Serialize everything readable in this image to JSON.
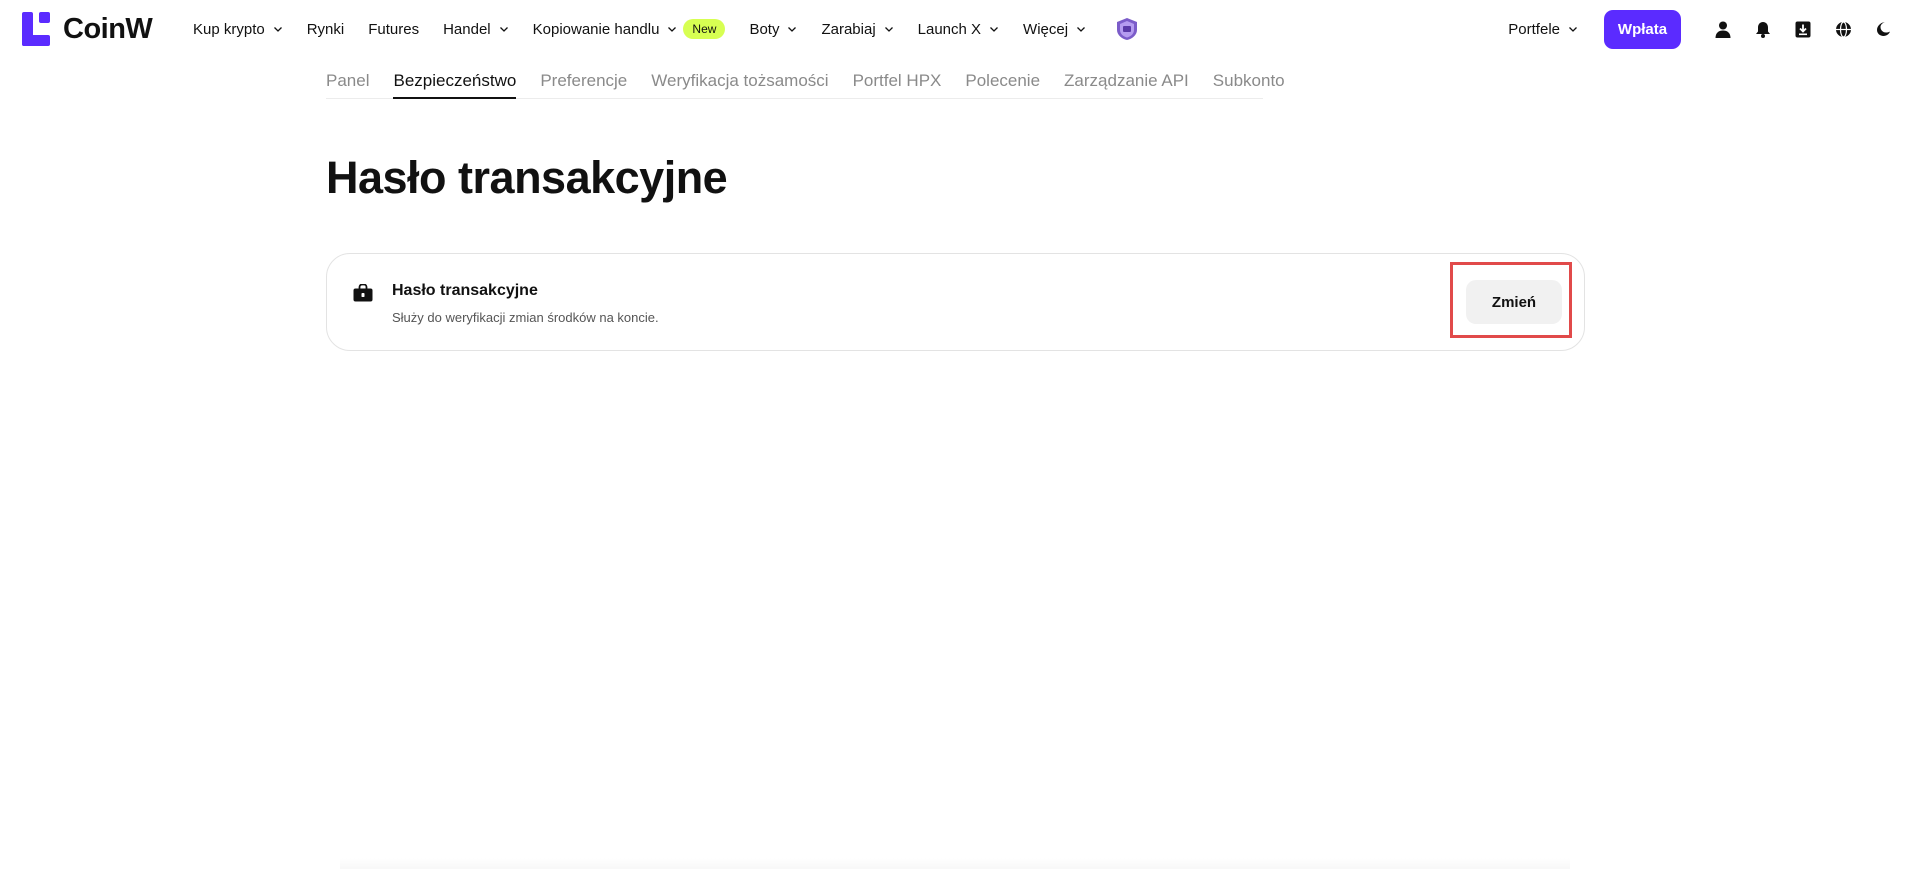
{
  "brand": {
    "name": "CoinW",
    "color": "#5b2bff"
  },
  "nav": {
    "items": [
      {
        "label": "Kup krypto",
        "dropdown": true
      },
      {
        "label": "Rynki",
        "dropdown": false
      },
      {
        "label": "Futures",
        "dropdown": false
      },
      {
        "label": "Handel",
        "dropdown": true
      },
      {
        "label": "Kopiowanie handlu",
        "dropdown": true,
        "badge": "New"
      },
      {
        "label": "Boty",
        "dropdown": true
      },
      {
        "label": "Zarabiaj",
        "dropdown": true
      },
      {
        "label": "Launch X",
        "dropdown": true
      },
      {
        "label": "Więcej",
        "dropdown": true
      }
    ],
    "badge_color": "#d7ff52",
    "vip_icon": "vip-badge-icon"
  },
  "header_right": {
    "portfolio_label": "Portfele",
    "deposit_label": "Wpłata",
    "icons": [
      "user-icon",
      "bell-icon",
      "download-icon",
      "globe-icon",
      "moon-icon"
    ]
  },
  "subnav": {
    "tabs": [
      {
        "label": "Panel",
        "active": false
      },
      {
        "label": "Bezpieczeństwo",
        "active": true
      },
      {
        "label": "Preferencje",
        "active": false
      },
      {
        "label": "Weryfikacja tożsamości",
        "active": false
      },
      {
        "label": "Portfel HPX",
        "active": false
      },
      {
        "label": "Polecenie",
        "active": false
      },
      {
        "label": "Zarządzanie API",
        "active": false
      },
      {
        "label": "Subkonto",
        "active": false
      }
    ]
  },
  "main": {
    "title": "Hasło transakcyjne",
    "card": {
      "icon": "lock-bag-icon",
      "title": "Hasło transakcyjne",
      "description": "Służy do weryfikacji zmian środków na koncie.",
      "button_label": "Zmień"
    },
    "highlight_color": "#e14a4a"
  }
}
